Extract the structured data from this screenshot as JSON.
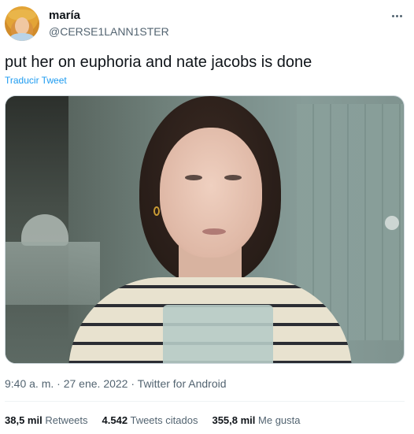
{
  "user": {
    "display_name": "maría",
    "handle": "@CERSE1LANN1STER"
  },
  "tweet": {
    "text": "put her on euphoria and nate jacobs is done",
    "translate_label": "Traducir Tweet"
  },
  "meta": {
    "time": "9:40 a. m.",
    "date": "27 ene. 2022",
    "separator": "·",
    "source": "Twitter for Android"
  },
  "stats": {
    "retweets_count": "38,5 mil",
    "retweets_label": "Retweets",
    "quotes_count": "4.542",
    "quotes_label": "Tweets citados",
    "likes_count": "355,8 mil",
    "likes_label": "Me gusta"
  },
  "colors": {
    "link": "#1d9bf0",
    "secondary_text": "#536471",
    "primary_text": "#0f1419"
  },
  "icons": {
    "more": "more-horizontal-icon"
  }
}
